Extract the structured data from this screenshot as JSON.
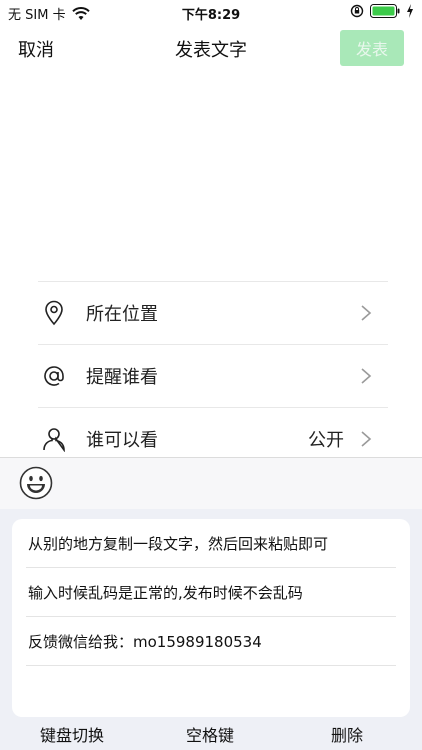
{
  "status_bar": {
    "carrier": "无 SIM 卡",
    "time": "下午8:29"
  },
  "nav": {
    "cancel_label": "取消",
    "title": "发表文字",
    "publish_label": "发表"
  },
  "options": [
    {
      "label": "所在位置",
      "icon": "location-pin-icon",
      "value": ""
    },
    {
      "label": "提醒谁看",
      "icon": "at-icon",
      "value": ""
    },
    {
      "label": "谁可以看",
      "icon": "person-icon",
      "value": "公开"
    }
  ],
  "phrases": [
    "从别的地方复制一段文字，然后回来粘贴即可",
    "输入时候乱码是正常的,发布时候不会乱码",
    "反馈微信给我：mo15989180534",
    ""
  ],
  "keyboard": {
    "switch_label": "键盘切换",
    "space_label": "空格键",
    "delete_label": "删除"
  },
  "colors": {
    "publish_bg": "#a9e8b8",
    "panel_bg": "#eef0f6"
  }
}
